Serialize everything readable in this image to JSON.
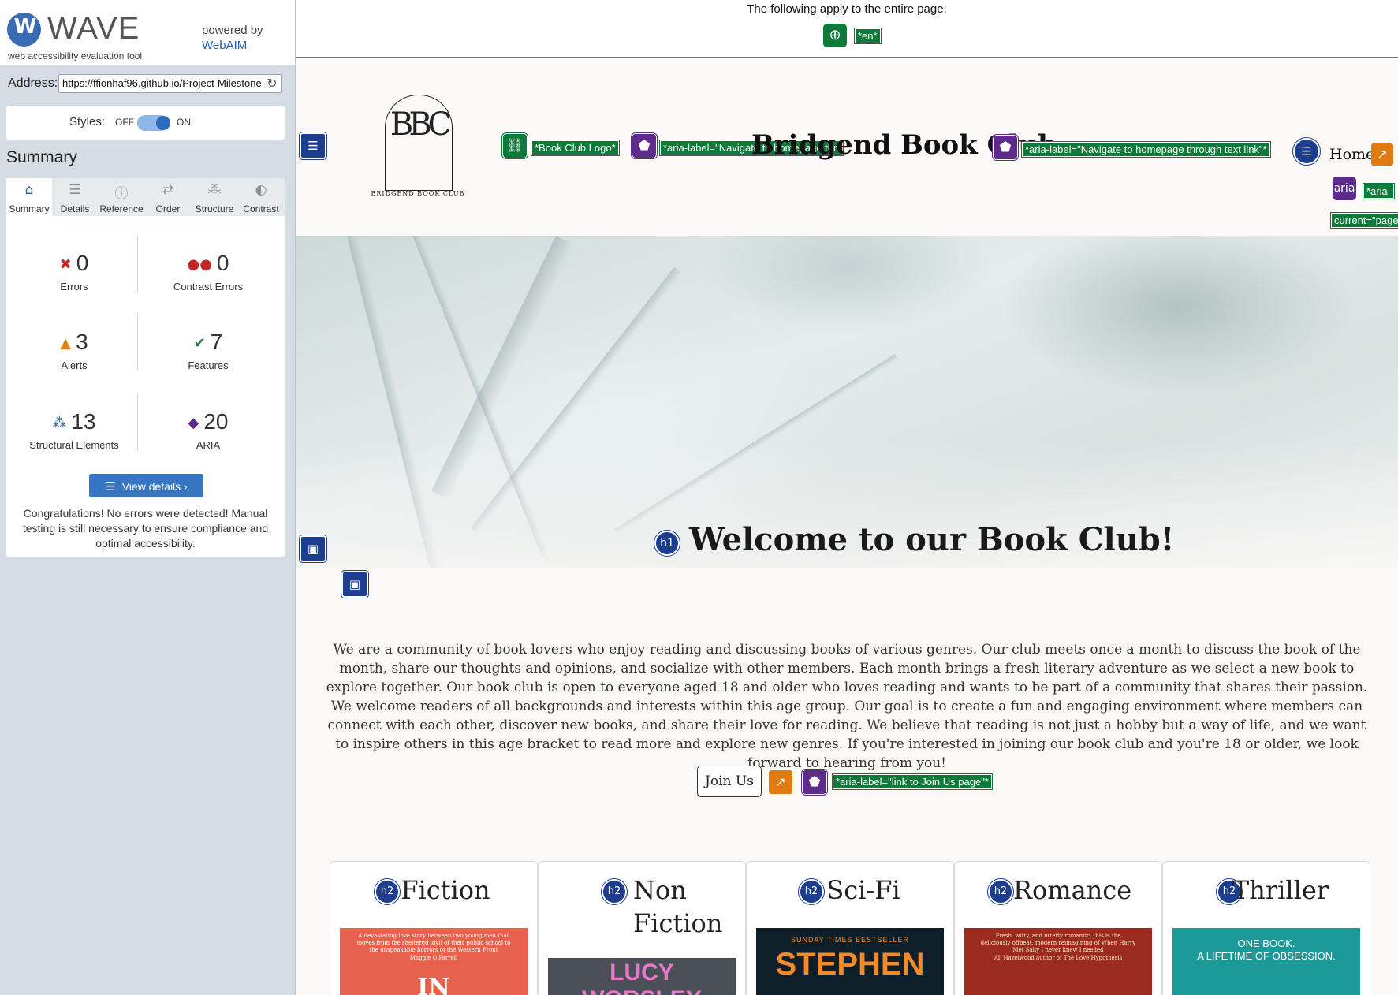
{
  "wave": {
    "logo_letter": "W",
    "title": "WAVE",
    "subtitle": "web accessibility evaluation tool",
    "powered_by": "powered by",
    "webaim_link": "WebAIM",
    "address_label": "Address:",
    "address_value": "https://ffionhaf96.github.io/Project-Milestone",
    "styles_label": "Styles:",
    "styles_off": "OFF",
    "styles_on": "ON",
    "summary_heading": "Summary",
    "tabs": [
      {
        "label": "Summary",
        "icon": "home-icon",
        "glyph": "⌂"
      },
      {
        "label": "Details",
        "icon": "list-icon",
        "glyph": "☰"
      },
      {
        "label": "Reference",
        "icon": "info-icon",
        "glyph": "ⓘ"
      },
      {
        "label": "Order",
        "icon": "order-icon",
        "glyph": "⇄"
      },
      {
        "label": "Structure",
        "icon": "structure-icon",
        "glyph": "⁂"
      },
      {
        "label": "Contrast",
        "icon": "contrast-icon",
        "glyph": "◐"
      }
    ],
    "stats": {
      "errors": {
        "value": "0",
        "label": "Errors",
        "color": "#c62828"
      },
      "contrast_errors": {
        "value": "0",
        "label": "Contrast Errors",
        "color": "#c62828"
      },
      "alerts": {
        "value": "3",
        "label": "Alerts",
        "color": "#e0861b"
      },
      "features": {
        "value": "7",
        "label": "Features",
        "color": "#2e7d4f"
      },
      "structural": {
        "value": "13",
        "label": "Structural Elements",
        "color": "#2f5ea8"
      },
      "aria": {
        "value": "20",
        "label": "ARIA",
        "color": "#5d2b8a"
      }
    },
    "view_details": "View details ›",
    "congrats": "Congratulations! No errors were detected! Manual testing is still necessary to ensure compliance and optimal accessibility."
  },
  "page": {
    "banner_text": "The following apply to the entire page:",
    "lang_label": "*en*",
    "logo_monogram": "BBC",
    "logo_caption": "BRIDGEND BOOK CLUB",
    "brand_title": "Bridgend Book Club",
    "logo_alt_label": "*Book Club Logo*",
    "aria_label_1": "*aria-label=\"Navigate to homepage through logo\"*",
    "aria_label_2": "*aria-label=\"Navigate to homepage through text link\"*",
    "nav_home": "Home",
    "aria_badge": "aria",
    "aria_current_1": "*aria-",
    "aria_current_2": "current=\"page",
    "h1_badge": "h1",
    "hero_heading": "Welcome to our Book Club!",
    "intro_text": "We are a community of book lovers who enjoy reading and discussing books of various genres. Our club meets once a month to discuss the book of the month, share our thoughts and opinions, and socialize with other members. Each month brings a fresh literary adventure as we select a new book to explore together. Our book club is open to everyone aged 18 and older who loves reading and wants to be part of a community that shares their passion. We welcome readers of all backgrounds and interests within this age group. Our goal is to create a fun and engaging environment where members can connect with each other, discover new books, and share their love for reading. We believe that reading is not just a hobby but a way of life, and we want to inspire others in this age bracket to read more and explore new genres. If you're interested in joining our book club and you're 18 or older, we look forward to hearing from you!",
    "join_button": "Join Us",
    "aria_label_3": "*aria-label=\"link to Join Us page\"*",
    "genres": [
      {
        "badge": "h2",
        "title": "Fiction",
        "cover_color": "#e8614c",
        "cover_line1": "A devastating love story between two young men that moves from the sheltered idyll of their public school to the unspeakable horrors of the Western Front",
        "cover_line2": "Maggie O'Farrell",
        "cover_big": "IN",
        "cover_text_color": "#ffffff"
      },
      {
        "badge": "h2",
        "title": "Non Fiction",
        "cover_color": "#4a4f58",
        "cover_line1": "",
        "cover_line2": "",
        "cover_big": "LUCY WORSLEY",
        "cover_text_color": "#e879c8"
      },
      {
        "badge": "h2",
        "title": "Sci-Fi",
        "cover_color": "#0f1f2a",
        "cover_line1": "SUNDAY TIMES BESTSELLER",
        "cover_line2": "",
        "cover_big": "STEPHEN",
        "cover_text_color": "#f08a2a"
      },
      {
        "badge": "h2",
        "title": "Romance",
        "cover_color": "#9a2b1e",
        "cover_line1": "Fresh, witty, and utterly romantic, this is the deliciously offbeat, modern reimagining of When Harry Met Sally I never knew I needed",
        "cover_line2": "Ali Hazelwood author of The Love Hypothesis",
        "cover_big": "",
        "cover_text_color": "#ffe9c4"
      },
      {
        "badge": "h2",
        "title": "Thriller",
        "cover_color": "#1c9a9a",
        "cover_line1": "ONE BOOK.",
        "cover_line2": "A LIFETIME OF OBSESSION.",
        "cover_big": "",
        "cover_text_color": "#ffffff"
      }
    ]
  }
}
